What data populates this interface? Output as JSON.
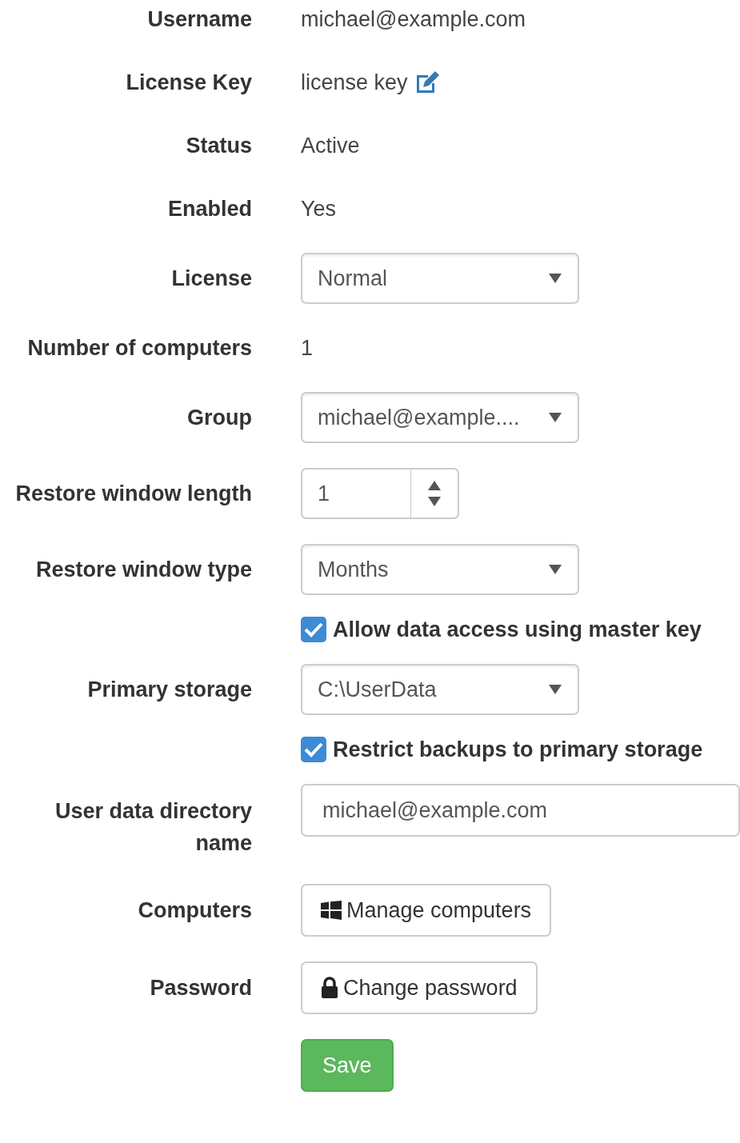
{
  "rows": [
    {
      "kind": "text",
      "label": "Username",
      "value": "michael@example.com"
    },
    {
      "kind": "text_edit",
      "label": "License Key",
      "value": "license key"
    },
    {
      "kind": "text",
      "label": "Status",
      "value": "Active"
    },
    {
      "kind": "text",
      "label": "Enabled",
      "value": "Yes"
    },
    {
      "kind": "select",
      "label": "License",
      "value": "Normal"
    },
    {
      "kind": "text",
      "label": "Number of computers",
      "value": "1"
    },
    {
      "kind": "select",
      "label": "Group",
      "value": "michael@example...."
    },
    {
      "kind": "number",
      "label": "Restore window length",
      "value": "1"
    },
    {
      "kind": "select",
      "label": "Restore window type",
      "value": "Months"
    },
    {
      "kind": "checkbox",
      "text": "Allow data access using master key",
      "checked": true
    },
    {
      "kind": "select",
      "label": "Primary storage",
      "value": "C:\\UserData"
    },
    {
      "kind": "checkbox",
      "text": "Restrict backups to primary storage",
      "checked": true
    },
    {
      "kind": "input",
      "label": "User data directory name",
      "value": "michael@example.com"
    },
    {
      "kind": "windows_button",
      "label": "Computers",
      "text": "Manage computers"
    },
    {
      "kind": "lock_button",
      "label": "Password",
      "text": "Change password"
    },
    {
      "kind": "submit",
      "text": "Save"
    }
  ]
}
